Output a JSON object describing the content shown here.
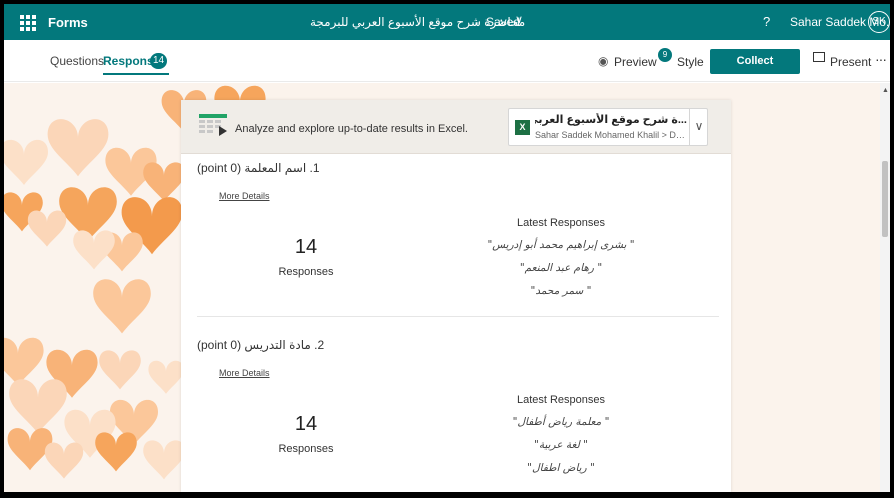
{
  "topbar": {
    "app_name": "Forms",
    "doc_title": "محاضرة شرح موقع الأسبوع العربي للبرمجة",
    "separator": "-",
    "saved_label": "Saved",
    "help_label": "?",
    "user_name": "Sahar Saddek Mo...",
    "user_initials": "SK"
  },
  "tabs": {
    "questions_label": "Questions",
    "responses_label": "Responses",
    "responses_count": "14"
  },
  "toolbar": {
    "preview_label": "Preview",
    "style_label": "Style",
    "style_badge": "9",
    "collect_label": "Collect responses",
    "present_label": "Present",
    "more_label": "···"
  },
  "excel_bar": {
    "text": "Analyze and explore up-to-date results in Excel.",
    "file_title": "...ة شرح موقع الأسبوع العربي للبرمجة",
    "file_path": "Sahar Saddek Mohamed Khalil > Docum...",
    "file_icon_label": "X"
  },
  "questions": [
    {
      "number": "1.",
      "title": "اسم المعلمة",
      "points": "(0 point)",
      "more_details": "More Details",
      "count": "14",
      "count_label": "Responses",
      "latest_heading": "Latest Responses",
      "latest": [
        "\" بشرى إبراهيم محمد أبو إدريس\"",
        "\" رهام عبد المنعم\"",
        "\" سمر محمد\""
      ]
    },
    {
      "number": "2.",
      "title": "مادة التدريس",
      "points": "(0 point)",
      "more_details": "More Details",
      "count": "14",
      "count_label": "Responses",
      "latest_heading": "Latest Responses",
      "latest": [
        "\" معلمة رياض أطفال\"",
        "\" لغة عربية\"",
        "\" رياض اطفال\""
      ]
    }
  ],
  "colors": {
    "brand": "#03787c",
    "heart_light": "#fbd6b8",
    "heart_mid": "#f8b378",
    "heart_dark": "#f5a55c"
  }
}
